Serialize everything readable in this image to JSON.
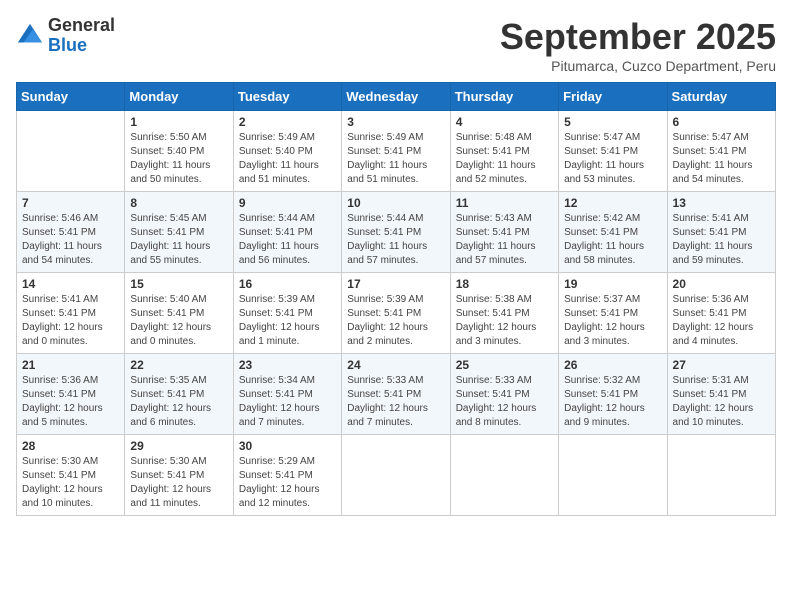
{
  "logo": {
    "general": "General",
    "blue": "Blue"
  },
  "title": "September 2025",
  "subtitle": "Pitumarca, Cuzco Department, Peru",
  "days": [
    "Sunday",
    "Monday",
    "Tuesday",
    "Wednesday",
    "Thursday",
    "Friday",
    "Saturday"
  ],
  "weeks": [
    [
      {
        "num": "",
        "info": ""
      },
      {
        "num": "1",
        "info": "Sunrise: 5:50 AM\nSunset: 5:40 PM\nDaylight: 11 hours\nand 50 minutes."
      },
      {
        "num": "2",
        "info": "Sunrise: 5:49 AM\nSunset: 5:40 PM\nDaylight: 11 hours\nand 51 minutes."
      },
      {
        "num": "3",
        "info": "Sunrise: 5:49 AM\nSunset: 5:41 PM\nDaylight: 11 hours\nand 51 minutes."
      },
      {
        "num": "4",
        "info": "Sunrise: 5:48 AM\nSunset: 5:41 PM\nDaylight: 11 hours\nand 52 minutes."
      },
      {
        "num": "5",
        "info": "Sunrise: 5:47 AM\nSunset: 5:41 PM\nDaylight: 11 hours\nand 53 minutes."
      },
      {
        "num": "6",
        "info": "Sunrise: 5:47 AM\nSunset: 5:41 PM\nDaylight: 11 hours\nand 54 minutes."
      }
    ],
    [
      {
        "num": "7",
        "info": "Sunrise: 5:46 AM\nSunset: 5:41 PM\nDaylight: 11 hours\nand 54 minutes."
      },
      {
        "num": "8",
        "info": "Sunrise: 5:45 AM\nSunset: 5:41 PM\nDaylight: 11 hours\nand 55 minutes."
      },
      {
        "num": "9",
        "info": "Sunrise: 5:44 AM\nSunset: 5:41 PM\nDaylight: 11 hours\nand 56 minutes."
      },
      {
        "num": "10",
        "info": "Sunrise: 5:44 AM\nSunset: 5:41 PM\nDaylight: 11 hours\nand 57 minutes."
      },
      {
        "num": "11",
        "info": "Sunrise: 5:43 AM\nSunset: 5:41 PM\nDaylight: 11 hours\nand 57 minutes."
      },
      {
        "num": "12",
        "info": "Sunrise: 5:42 AM\nSunset: 5:41 PM\nDaylight: 11 hours\nand 58 minutes."
      },
      {
        "num": "13",
        "info": "Sunrise: 5:41 AM\nSunset: 5:41 PM\nDaylight: 11 hours\nand 59 minutes."
      }
    ],
    [
      {
        "num": "14",
        "info": "Sunrise: 5:41 AM\nSunset: 5:41 PM\nDaylight: 12 hours\nand 0 minutes."
      },
      {
        "num": "15",
        "info": "Sunrise: 5:40 AM\nSunset: 5:41 PM\nDaylight: 12 hours\nand 0 minutes."
      },
      {
        "num": "16",
        "info": "Sunrise: 5:39 AM\nSunset: 5:41 PM\nDaylight: 12 hours\nand 1 minute."
      },
      {
        "num": "17",
        "info": "Sunrise: 5:39 AM\nSunset: 5:41 PM\nDaylight: 12 hours\nand 2 minutes."
      },
      {
        "num": "18",
        "info": "Sunrise: 5:38 AM\nSunset: 5:41 PM\nDaylight: 12 hours\nand 3 minutes."
      },
      {
        "num": "19",
        "info": "Sunrise: 5:37 AM\nSunset: 5:41 PM\nDaylight: 12 hours\nand 3 minutes."
      },
      {
        "num": "20",
        "info": "Sunrise: 5:36 AM\nSunset: 5:41 PM\nDaylight: 12 hours\nand 4 minutes."
      }
    ],
    [
      {
        "num": "21",
        "info": "Sunrise: 5:36 AM\nSunset: 5:41 PM\nDaylight: 12 hours\nand 5 minutes."
      },
      {
        "num": "22",
        "info": "Sunrise: 5:35 AM\nSunset: 5:41 PM\nDaylight: 12 hours\nand 6 minutes."
      },
      {
        "num": "23",
        "info": "Sunrise: 5:34 AM\nSunset: 5:41 PM\nDaylight: 12 hours\nand 7 minutes."
      },
      {
        "num": "24",
        "info": "Sunrise: 5:33 AM\nSunset: 5:41 PM\nDaylight: 12 hours\nand 7 minutes."
      },
      {
        "num": "25",
        "info": "Sunrise: 5:33 AM\nSunset: 5:41 PM\nDaylight: 12 hours\nand 8 minutes."
      },
      {
        "num": "26",
        "info": "Sunrise: 5:32 AM\nSunset: 5:41 PM\nDaylight: 12 hours\nand 9 minutes."
      },
      {
        "num": "27",
        "info": "Sunrise: 5:31 AM\nSunset: 5:41 PM\nDaylight: 12 hours\nand 10 minutes."
      }
    ],
    [
      {
        "num": "28",
        "info": "Sunrise: 5:30 AM\nSunset: 5:41 PM\nDaylight: 12 hours\nand 10 minutes."
      },
      {
        "num": "29",
        "info": "Sunrise: 5:30 AM\nSunset: 5:41 PM\nDaylight: 12 hours\nand 11 minutes."
      },
      {
        "num": "30",
        "info": "Sunrise: 5:29 AM\nSunset: 5:41 PM\nDaylight: 12 hours\nand 12 minutes."
      },
      {
        "num": "",
        "info": ""
      },
      {
        "num": "",
        "info": ""
      },
      {
        "num": "",
        "info": ""
      },
      {
        "num": "",
        "info": ""
      }
    ]
  ]
}
